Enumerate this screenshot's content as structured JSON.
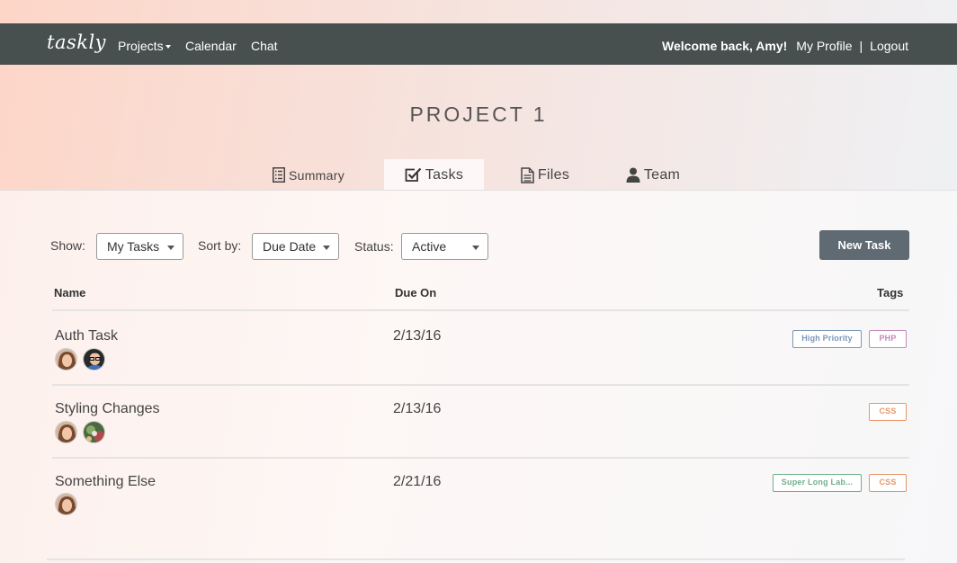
{
  "nav": {
    "logo": "taskly",
    "links": [
      "Projects",
      "Calendar",
      "Chat"
    ],
    "welcome": "Welcome back, Amy!",
    "profile": "My Profile",
    "separator": "|",
    "logout": "Logout"
  },
  "page": {
    "title": "PROJECT 1"
  },
  "tabs": [
    {
      "label": "Summary",
      "icon": "list-icon"
    },
    {
      "label": "Tasks",
      "icon": "checkbox-icon",
      "active": true
    },
    {
      "label": "Files",
      "icon": "document-icon"
    },
    {
      "label": "Team",
      "icon": "user-icon"
    }
  ],
  "filters": {
    "show_label": "Show:",
    "show_value": "My Tasks",
    "sort_label": "Sort by:",
    "sort_value": "Due Date",
    "status_label": "Status:",
    "status_value": "Active"
  },
  "new_task_label": "New Task",
  "table": {
    "headers": {
      "name": "Name",
      "due": "Due On",
      "tags": "Tags"
    },
    "rows": [
      {
        "name": "Auth Task",
        "due": "2/13/16",
        "tags": [
          "High Priority",
          "PHP"
        ]
      },
      {
        "name": "Styling Changes",
        "due": "2/13/16",
        "tags": [
          "CSS"
        ]
      },
      {
        "name": "Something Else",
        "due": "2/21/16",
        "tags": [
          "Super Long Lab...",
          "CSS"
        ]
      }
    ]
  },
  "colors": {
    "nav_bg": "#474f4f",
    "button_bg": "#5f6a72",
    "tag_high_priority": "#7a98b6",
    "tag_php": "#c58ab8",
    "tag_css": "#e8966a",
    "tag_super_long": "#6fb08a"
  }
}
